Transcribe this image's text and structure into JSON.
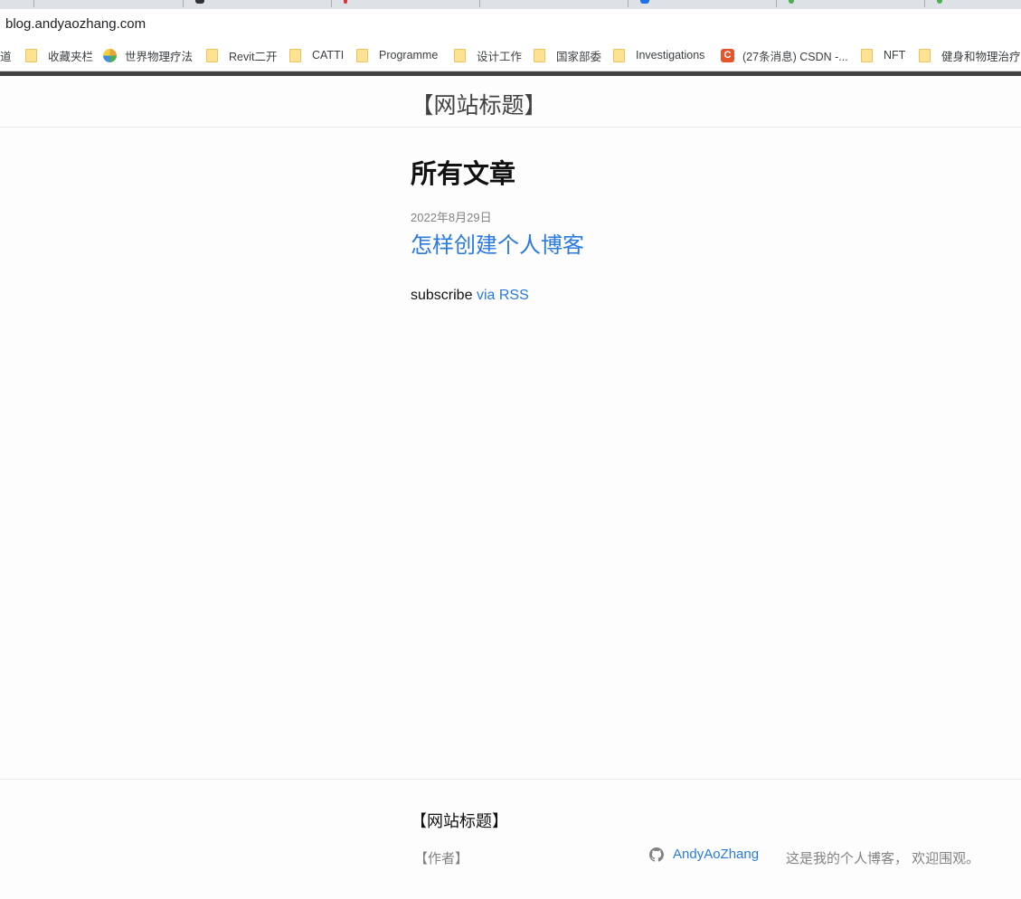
{
  "browser": {
    "url": "blog.andyaozhang.com",
    "bookmarks": [
      {
        "label": "道",
        "icon": "none"
      },
      {
        "label": "收藏夹栏",
        "icon": "folder-icon"
      },
      {
        "label": "世界物理疗法",
        "icon": "globe-icon"
      },
      {
        "label": "Revit二开",
        "icon": "folder-icon"
      },
      {
        "label": "CATTI",
        "icon": "folder-icon"
      },
      {
        "label": "Programme",
        "icon": "folder-icon"
      },
      {
        "label": "设计工作",
        "icon": "folder-icon"
      },
      {
        "label": "国家部委",
        "icon": "folder-icon"
      },
      {
        "label": "Investigations",
        "icon": "folder-icon"
      },
      {
        "label": "(27条消息) CSDN -...",
        "icon": "csdn-icon",
        "icon_text": "C"
      },
      {
        "label": "NFT",
        "icon": "folder-icon"
      },
      {
        "label": "健身和物理治疗",
        "icon": "folder-icon"
      }
    ]
  },
  "site": {
    "title": "【网站标题】"
  },
  "main": {
    "heading": "所有文章",
    "posts": [
      {
        "date": "2022年8月29日",
        "title": "怎样创建个人博客"
      }
    ],
    "rss_prefix": "subscribe",
    "rss_link": "via RSS"
  },
  "footer": {
    "heading": "【网站标题】",
    "author": "【作者】",
    "github_user": "AndyAoZhang",
    "description": "这是我的个人博客， 欢迎围观。"
  },
  "colors": {
    "link": "#2a7ae2",
    "meta_grey": "#828282",
    "topbar": "#424242"
  }
}
